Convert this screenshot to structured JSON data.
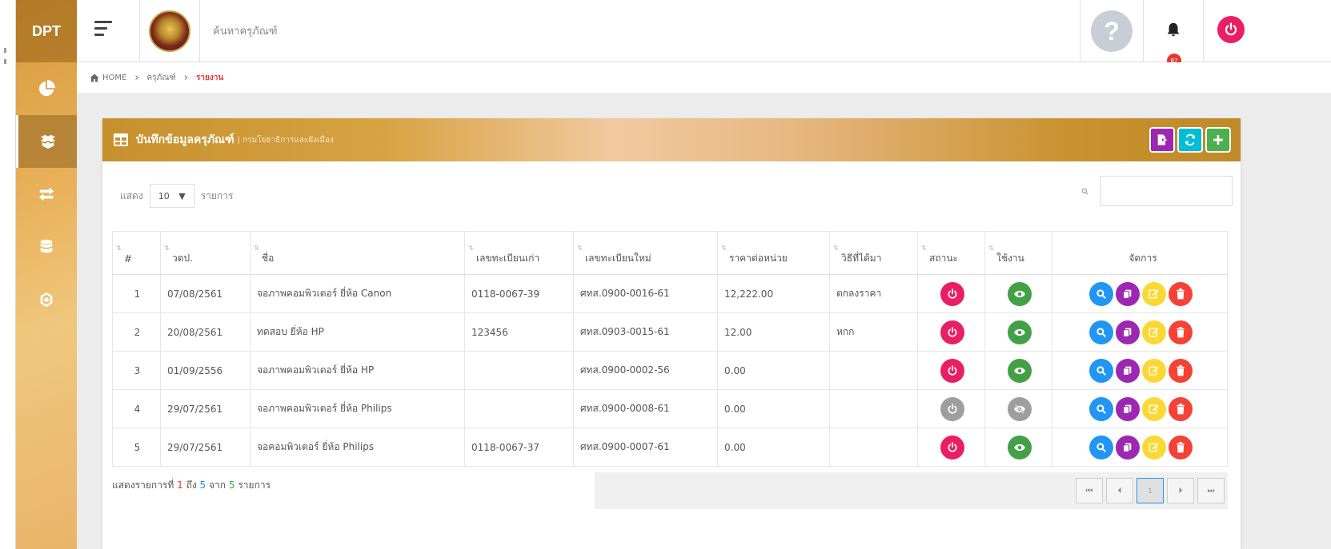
{
  "app": {
    "brand": "DPT",
    "search_placeholder": "ค้นหาครุภัณฑ์",
    "notification_count": "87"
  },
  "breadcrumb": {
    "home": "HOME",
    "section": "ครุภัณฑ์",
    "current": "รายงาน"
  },
  "card": {
    "title": "บันทึกข้อมูลครุภัณฑ์",
    "subtitle": "| กรมโยธาธิการและผังเมือง"
  },
  "length": {
    "prefix": "แสดง",
    "value": "10",
    "suffix": "รายการ"
  },
  "table": {
    "headers": [
      "#",
      "วดป.",
      "ชื่อ",
      "เลขทะเบียนเก่า",
      "เลขทะเบียนใหม่",
      "ราคาต่อหน่วย",
      "วิธีที่ได้มา",
      "สถานะ",
      "ใช้งาน",
      "จัดการ"
    ],
    "rows": [
      {
        "no": "1",
        "date": "07/08/2561",
        "name": "จอภาพคอมพิวเตอร์ ยี่ห้อ Canon",
        "old_reg": "0118-0067-39",
        "new_reg": "ศทส.0900-0016-61",
        "price": "12,222.00",
        "method": "ตกลงราคา",
        "status": "active",
        "use": "visible"
      },
      {
        "no": "2",
        "date": "20/08/2561",
        "name": "ทดสอบ ยี่ห้อ HP",
        "old_reg": "123456",
        "new_reg": "ศทส.0903-0015-61",
        "price": "12.00",
        "method": "หกก",
        "status": "active",
        "use": "visible"
      },
      {
        "no": "3",
        "date": "01/09/2556",
        "name": "จอภาพคอมพิวเตอร์ ยี่ห้อ HP",
        "old_reg": "",
        "new_reg": "ศทส.0900-0002-56",
        "price": "0.00",
        "method": "",
        "status": "active",
        "use": "visible"
      },
      {
        "no": "4",
        "date": "29/07/2561",
        "name": "จอภาพคอมพิวเตอร์ ยี่ห้อ Philips",
        "old_reg": "",
        "new_reg": "ศทส.0900-0008-61",
        "price": "0.00",
        "method": "",
        "status": "inactive",
        "use": "hidden"
      },
      {
        "no": "5",
        "date": "29/07/2561",
        "name": "จอคอมพิวเตอร์ ยี่ห้อ Philips",
        "old_reg": "0118-0067-37",
        "new_reg": "ศทส.0900-0007-61",
        "price": "0.00",
        "method": "",
        "status": "active",
        "use": "visible"
      }
    ]
  },
  "info": {
    "prefix": "แสดงรายการที่",
    "from": "1",
    "to_word": "ถึง",
    "to": "5",
    "of_word": "จาก",
    "total": "5",
    "suffix": "รายการ"
  },
  "pager": {
    "current": "1"
  },
  "colors": {
    "power_on": "#e91e63",
    "power_off": "#9e9e9e",
    "eye_on": "#43a047",
    "eye_off": "#9e9e9e",
    "search": "#2196f3",
    "copy": "#9c27b0",
    "edit": "#fdd835",
    "delete": "#f44336"
  },
  "icons": {
    "sidebar": [
      "pie-chart-icon",
      "boxes-icon",
      "transfer-icon",
      "database-icon",
      "settings-icon"
    ]
  }
}
